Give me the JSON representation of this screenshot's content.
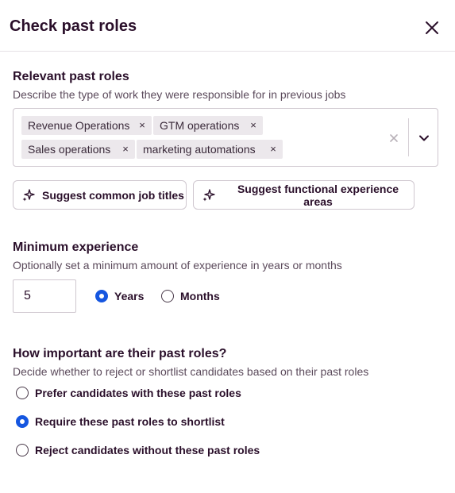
{
  "header": {
    "title": "Check past roles"
  },
  "past_roles": {
    "title": "Relevant past roles",
    "description": "Describe the type of work they were responsible for in previous jobs",
    "tags": [
      {
        "label": "Revenue Operations"
      },
      {
        "label": "GTM operations"
      },
      {
        "label": "Sales operations"
      },
      {
        "label": "marketing automations"
      }
    ],
    "remove_glyph": "×",
    "suggest_buttons": [
      {
        "label": "Suggest common job titles"
      },
      {
        "label": "Suggest functional experience areas"
      }
    ]
  },
  "min_experience": {
    "title": "Minimum experience",
    "description": "Optionally set a minimum amount of experience in years or months",
    "value": "5",
    "units": [
      {
        "label": "Years",
        "selected": true
      },
      {
        "label": "Months",
        "selected": false
      }
    ]
  },
  "importance": {
    "title": "How important are their past roles?",
    "description": "Decide whether to reject or shortlist candidates based on their past roles",
    "options": [
      {
        "label": "Prefer candidates with these past roles",
        "selected": false
      },
      {
        "label": "Require these past roles to shortlist",
        "selected": true
      },
      {
        "label": "Reject candidates without these past roles",
        "selected": false
      }
    ]
  },
  "colors": {
    "accent": "#1556e0",
    "text": "#2a0f2a",
    "tag_bg": "#ece8ec"
  },
  "icons": [
    "close-icon",
    "sparkle-icon",
    "clear-icon",
    "chevron-down-icon"
  ]
}
